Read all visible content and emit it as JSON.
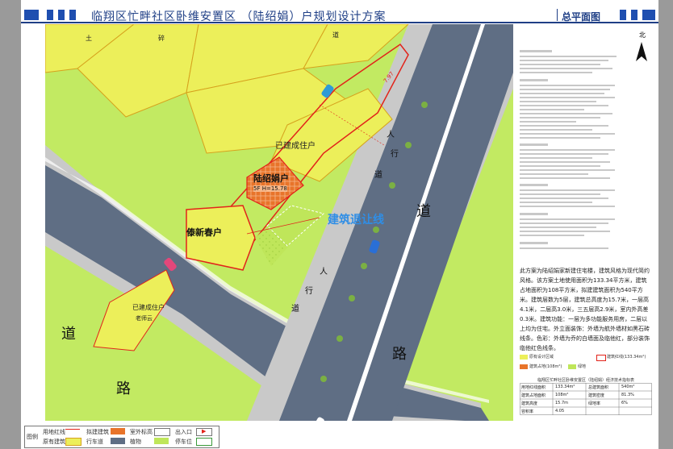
{
  "header": {
    "title": "临翔区忙畔社区卧维安置区 （陆绍娟）户规划设计方案",
    "sheet_name": "总平面图"
  },
  "north": {
    "label": "北"
  },
  "map": {
    "roads": {
      "road_char_1": "道",
      "road_char_2": "路",
      "road_char_3": "道",
      "road_char_4": "路"
    },
    "sidewalk_chars": [
      "人",
      "行",
      "道",
      "人",
      "行",
      "道"
    ],
    "lots": {
      "subject": "陆绍娟户",
      "subject_height": "5F H=15.78",
      "built_center": "已建成住户",
      "neighbor_left": "傣新春户",
      "built_bottom": "已建成住户",
      "built_bottom_sub": "老师云",
      "top_lot_1": "土",
      "top_lot_2": "碎",
      "top_lot_3": "道"
    },
    "setback_label": "建筑退让线",
    "dim_top": "7.97"
  },
  "design_text": "此方案为陆绍娟家新建住宅楼，建筑风格为现代简约风格。该方案土地使用面积为133.34平方米，建筑占地面积为108平方米，拟建建筑面积为540平方米。建筑层数为5层，建筑总高度为15.7米，一层高4.1米，二层高3.0米，三五层高2.9米，室内外高差0.3米。建筑功能：一层为多功能服务用房，二层以上均为住宅。外立面装饰：外墙为航外墙材如黑石砖线条。色彩：外墙为乔的白墙面及临他红，部分装饰临他红色线条。",
  "table": {
    "title": "临翔区忙畔社区卧维安置区（陆绍娟）经济技术指标表",
    "rows": [
      [
        "用地红线面积",
        "133.34m²",
        "总建筑面积",
        "540m²"
      ],
      [
        "建筑占地面积",
        "108m²",
        "建筑密度",
        "81.3%"
      ],
      [
        "建筑高度",
        "15.7m",
        "绿地率",
        "6%"
      ],
      [
        "容积率",
        "4.05",
        "",
        ""
      ]
    ],
    "key_labels": [
      "原有设计区域",
      "建筑占地(108m²)",
      "绿地",
      "建筑红线(133.34m²)"
    ]
  },
  "legend": {
    "row1": [
      "用地红线",
      "拟建建筑",
      "室外标高",
      "出入口"
    ],
    "row2": [
      "原有建筑",
      "行车道",
      "植物",
      "停车位"
    ],
    "side": "图例"
  },
  "colors": {
    "road": "#5f6e84",
    "sidewalk": "#c9c9c9",
    "yellow_lot": "#ecef5a",
    "green": "#bfe65a",
    "red_line": "#e2231a",
    "orange_building": "#e8742a",
    "accent_blue": "#1f4fb0"
  }
}
